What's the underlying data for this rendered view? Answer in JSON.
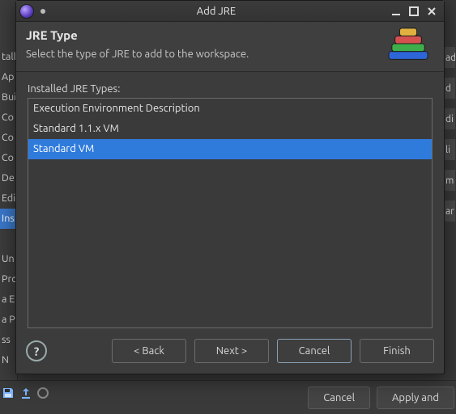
{
  "bg": {
    "left_items": [
      "tall",
      "Ap",
      "Bui",
      "Co",
      "Co",
      "Co",
      "De",
      "Edi",
      "Ins",
      "   ",
      "Un",
      "Pro",
      "a E",
      "a P",
      "ss",
      "N"
    ],
    "left_selected_index": 8,
    "right_chips": [
      "ad",
      "d",
      "di",
      "li",
      "m",
      "ar"
    ],
    "footer": {
      "cancel": "Cancel",
      "apply": "Apply and"
    }
  },
  "dialog": {
    "title": "Add JRE",
    "header": {
      "title": "JRE Type",
      "subtitle": "Select the type of JRE to add to the workspace."
    },
    "list_label": "Installed JRE Types:",
    "items": [
      "Execution Environment Description",
      "Standard 1.1.x VM",
      "Standard VM"
    ],
    "selected_index": 2,
    "buttons": {
      "back": "< Back",
      "next": "Next >",
      "cancel": "Cancel",
      "finish": "Finish"
    }
  }
}
